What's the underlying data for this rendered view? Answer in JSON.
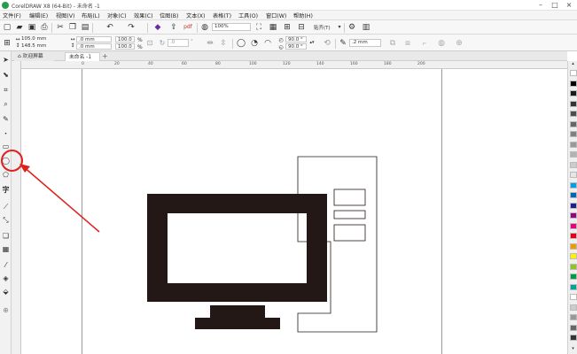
{
  "window": {
    "title": "CorelDRAW X8 (64-Bit) - 未命名 -1",
    "min_icon": "minimize-icon",
    "max_icon": "maximize-icon",
    "close_icon": "close-icon"
  },
  "menu": [
    "文件(F)",
    "编辑(E)",
    "视图(V)",
    "布局(L)",
    "对象(C)",
    "效果(C)",
    "位图(B)",
    "文本(X)",
    "表格(T)",
    "工具(O)",
    "窗口(W)",
    "帮助(H)"
  ],
  "toolbar1": {
    "zoom": "100%",
    "snap": "贴齐(T)"
  },
  "property_bar": {
    "width_val": "105.0 mm",
    "height_val": "148.5 mm",
    "x_val": ".0 mm",
    "y_val": ".0 mm",
    "scale_x": "100.0",
    "scale_y": "100.0",
    "rotate": ".0",
    "start_angle": "90.0 °",
    "end_angle": "90.0 °",
    "outline": ".2 mm"
  },
  "tabs": {
    "welcome": "欢迎屏幕",
    "document": "未命名 -1",
    "add": "+"
  },
  "ruler_h": [
    "0",
    "20",
    "40",
    "60",
    "80",
    "100",
    "120",
    "140",
    "160",
    "180",
    "200"
  ],
  "palette_colors": [
    "#ffffff",
    "#000000",
    "#1a1a1a",
    "#333333",
    "#4d4d4d",
    "#666666",
    "#808080",
    "#999999",
    "#b3b3b3",
    "#cccccc",
    "#e6e6e6",
    "#00a0e9",
    "#0068b7",
    "#1d2088",
    "#920783",
    "#e4007f",
    "#e60012",
    "#f39800",
    "#fff100",
    "#8fc31f",
    "#009944",
    "#00a29a",
    "#ffffff",
    "#cccccc",
    "#999999",
    "#666666",
    "#333333"
  ],
  "drawing": {
    "monitor_color": "#231815"
  },
  "annotation": {
    "color": "#e0201c"
  }
}
